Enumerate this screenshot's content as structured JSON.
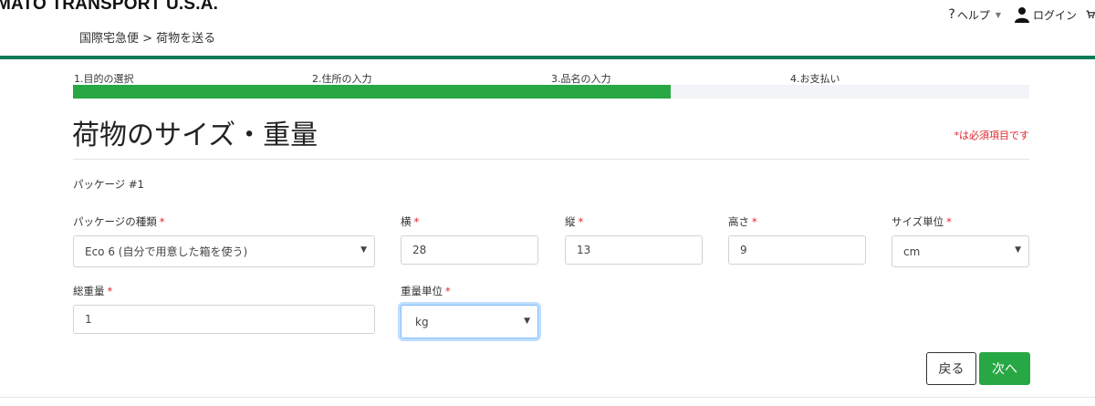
{
  "header": {
    "brand": "MATO TRANSPORT U.S.A.",
    "breadcrumb": "国際宅急便 > 荷物を送る",
    "help_label": "ヘルプ",
    "login_label": "ログイン"
  },
  "steps": [
    {
      "label": "1.目的の選択"
    },
    {
      "label": "2.住所の入力"
    },
    {
      "label": "3.品名の入力"
    },
    {
      "label": "4.お支払い"
    }
  ],
  "progress": {
    "fraction": 0.625,
    "color": "#28a745"
  },
  "page": {
    "title": "荷物のサイズ・重量",
    "required_note": "*は必須項目です",
    "package_title": "パッケージ #1"
  },
  "fields": {
    "package_type": {
      "label": "パッケージの種類",
      "value": "Eco 6 (自分で用意した箱を使う)"
    },
    "width": {
      "label": "横",
      "value": "28"
    },
    "length": {
      "label": "縦",
      "value": "13"
    },
    "height": {
      "label": "高さ",
      "value": "9"
    },
    "size_unit": {
      "label": "サイズ単位",
      "value": "cm"
    },
    "total_weight": {
      "label": "総重量",
      "value": "1"
    },
    "weight_unit": {
      "label": "重量単位",
      "value": "kg"
    },
    "required_mark": "*"
  },
  "buttons": {
    "back": "戻る",
    "next": "次へ"
  },
  "colors": {
    "accent_green": "#28a745",
    "header_rule": "#127a59",
    "required_red": "#e0242b",
    "focus_blue": "#80bdff"
  }
}
